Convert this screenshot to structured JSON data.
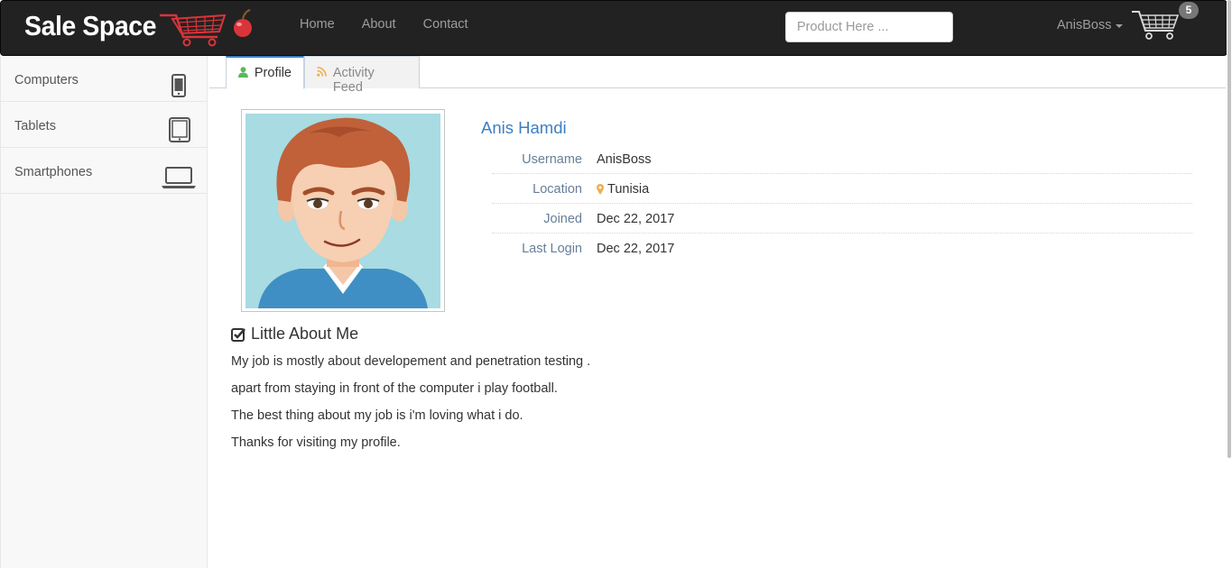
{
  "navbar": {
    "brand": "Sale Space",
    "links": [
      "Home",
      "About",
      "Contact"
    ],
    "search_placeholder": "Product Here ...",
    "user": "AnisBoss",
    "cart_count": "5"
  },
  "sidebar": {
    "items": [
      {
        "label": "Computers",
        "icon": "smartphone-icon"
      },
      {
        "label": "Tablets",
        "icon": "tablet-icon"
      },
      {
        "label": "Smartphones",
        "icon": "laptop-icon"
      }
    ]
  },
  "tabs": {
    "profile": "Profile",
    "activity": "Activity Feed"
  },
  "profile": {
    "name": "Anis Hamdi",
    "rows": [
      {
        "label": "Username",
        "value": "AnisBoss"
      },
      {
        "label": "Location",
        "value": "Tunisia"
      },
      {
        "label": "Joined",
        "value": "Dec 22, 2017"
      },
      {
        "label": "Last Login",
        "value": "Dec 22, 2017"
      }
    ]
  },
  "about": {
    "title": "Little About Me",
    "lines": [
      "My job is mostly about developement and penetration testing .",
      "apart from staying in front of the computer i play football.",
      "The best thing about my job is i'm loving what i do.",
      "Thanks for visiting my profile."
    ]
  },
  "colors": {
    "navbar_bg": "#222222",
    "link_blue": "#3d7fc1",
    "label_blue": "#667e99",
    "location_pin": "#f0ad4e",
    "profile_icon_green": "#5cb85c"
  }
}
